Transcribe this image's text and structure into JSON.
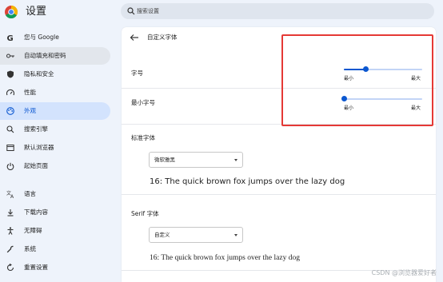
{
  "app": {
    "title": "设置",
    "search_placeholder": "搜索设置"
  },
  "sidebar": {
    "items": [
      {
        "label": "您与 Google",
        "icon": "google-g-icon"
      },
      {
        "label": "自动填充和密码",
        "icon": "key-icon",
        "state": "hover"
      },
      {
        "label": "隐私和安全",
        "icon": "shield-icon"
      },
      {
        "label": "性能",
        "icon": "speedometer-icon"
      },
      {
        "label": "外观",
        "icon": "palette-icon",
        "state": "active"
      },
      {
        "label": "搜索引擎",
        "icon": "search-icon"
      },
      {
        "label": "默认浏览器",
        "icon": "browser-window-icon"
      },
      {
        "label": "起始页面",
        "icon": "power-icon"
      },
      {
        "label": "语言",
        "icon": "translate-icon"
      },
      {
        "label": "下载内容",
        "icon": "download-icon"
      },
      {
        "label": "无障碍",
        "icon": "accessibility-icon"
      },
      {
        "label": "系统",
        "icon": "wrench-icon"
      },
      {
        "label": "重置设置",
        "icon": "reset-icon"
      }
    ]
  },
  "page": {
    "title": "自定义字体",
    "font_size": {
      "label": "字号",
      "min_label": "最小",
      "max_label": "最大",
      "value_fraction": 0.28
    },
    "min_font_size": {
      "label": "最小字号",
      "min_label": "最小",
      "max_label": "最大",
      "value_fraction": 0.0
    },
    "standard_font": {
      "label": "标准字体",
      "selected": "微软雅黑",
      "sample": "16: The quick brown fox jumps over the lazy dog"
    },
    "serif_font": {
      "label": "Serif 字体",
      "selected": "自定义",
      "sample": "16: The quick brown fox jumps over the lazy dog"
    }
  },
  "watermark": "CSDN @浏览器爱好者",
  "colors": {
    "accent": "#0b57d0",
    "active_bg": "#d3e3fd",
    "highlight": "#e53935"
  }
}
